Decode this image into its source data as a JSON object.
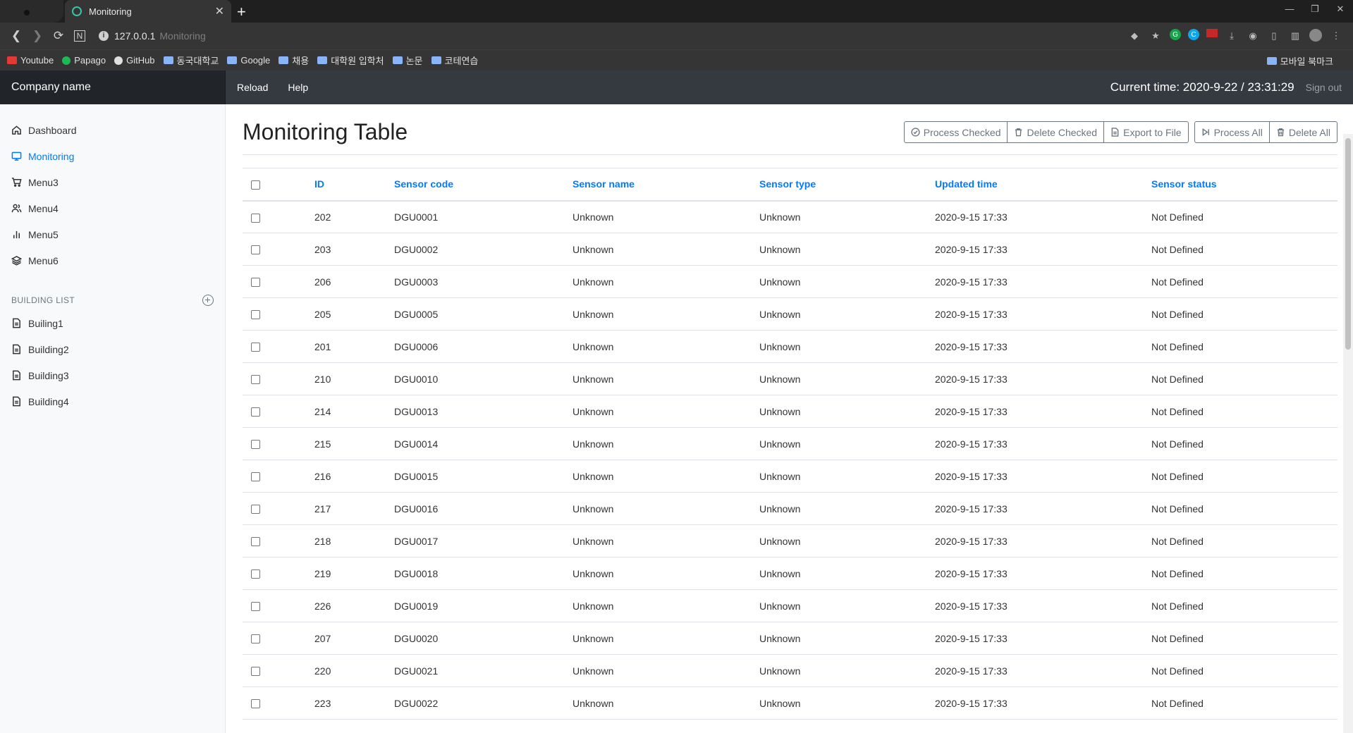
{
  "browser": {
    "tab_title": "Monitoring",
    "url_host": "127.0.0.1",
    "url_path": "Monitoring",
    "bookmarks": [
      "Youtube",
      "Papago",
      "GitHub",
      "동국대학교",
      "Google",
      "채용",
      "대학원 입학처",
      "논문",
      "코테연습"
    ],
    "bookmarks_right": "모바일 북마크"
  },
  "appbar": {
    "brand": "Company name",
    "nav": [
      "Reload",
      "Help"
    ],
    "clock": "Current time: 2020-9-22 / 23:31:29",
    "signout": "Sign out"
  },
  "sidebar": {
    "items": [
      {
        "label": "Dashboard",
        "icon": "home-icon"
      },
      {
        "label": "Monitoring",
        "icon": "monitor-icon",
        "active": true
      },
      {
        "label": "Menu3",
        "icon": "cart-icon"
      },
      {
        "label": "Menu4",
        "icon": "users-icon"
      },
      {
        "label": "Menu5",
        "icon": "bar-chart-icon"
      },
      {
        "label": "Menu6",
        "icon": "layers-icon"
      }
    ],
    "building_heading": "BUILDING LIST",
    "buildings": [
      "Builing1",
      "Building2",
      "Building3",
      "Building4"
    ]
  },
  "page": {
    "title": "Monitoring Table",
    "buttons_group1": [
      "Process Checked",
      "Delete Checked",
      "Export to File"
    ],
    "buttons_group2": [
      "Process All",
      "Delete All"
    ]
  },
  "table": {
    "headers": [
      "ID",
      "Sensor code",
      "Sensor name",
      "Sensor type",
      "Updated time",
      "Sensor status"
    ],
    "rows": [
      [
        "202",
        "DGU0001",
        "Unknown",
        "Unknown",
        "2020-9-15 17:33",
        "Not Defined"
      ],
      [
        "203",
        "DGU0002",
        "Unknown",
        "Unknown",
        "2020-9-15 17:33",
        "Not Defined"
      ],
      [
        "206",
        "DGU0003",
        "Unknown",
        "Unknown",
        "2020-9-15 17:33",
        "Not Defined"
      ],
      [
        "205",
        "DGU0005",
        "Unknown",
        "Unknown",
        "2020-9-15 17:33",
        "Not Defined"
      ],
      [
        "201",
        "DGU0006",
        "Unknown",
        "Unknown",
        "2020-9-15 17:33",
        "Not Defined"
      ],
      [
        "210",
        "DGU0010",
        "Unknown",
        "Unknown",
        "2020-9-15 17:33",
        "Not Defined"
      ],
      [
        "214",
        "DGU0013",
        "Unknown",
        "Unknown",
        "2020-9-15 17:33",
        "Not Defined"
      ],
      [
        "215",
        "DGU0014",
        "Unknown",
        "Unknown",
        "2020-9-15 17:33",
        "Not Defined"
      ],
      [
        "216",
        "DGU0015",
        "Unknown",
        "Unknown",
        "2020-9-15 17:33",
        "Not Defined"
      ],
      [
        "217",
        "DGU0016",
        "Unknown",
        "Unknown",
        "2020-9-15 17:33",
        "Not Defined"
      ],
      [
        "218",
        "DGU0017",
        "Unknown",
        "Unknown",
        "2020-9-15 17:33",
        "Not Defined"
      ],
      [
        "219",
        "DGU0018",
        "Unknown",
        "Unknown",
        "2020-9-15 17:33",
        "Not Defined"
      ],
      [
        "226",
        "DGU0019",
        "Unknown",
        "Unknown",
        "2020-9-15 17:33",
        "Not Defined"
      ],
      [
        "207",
        "DGU0020",
        "Unknown",
        "Unknown",
        "2020-9-15 17:33",
        "Not Defined"
      ],
      [
        "220",
        "DGU0021",
        "Unknown",
        "Unknown",
        "2020-9-15 17:33",
        "Not Defined"
      ],
      [
        "223",
        "DGU0022",
        "Unknown",
        "Unknown",
        "2020-9-15 17:33",
        "Not Defined"
      ]
    ]
  },
  "colors": {
    "accent": "#007bff",
    "navbar": "#343a40",
    "brand_bg": "#212529",
    "sidebar_bg": "#f8f9fa"
  }
}
